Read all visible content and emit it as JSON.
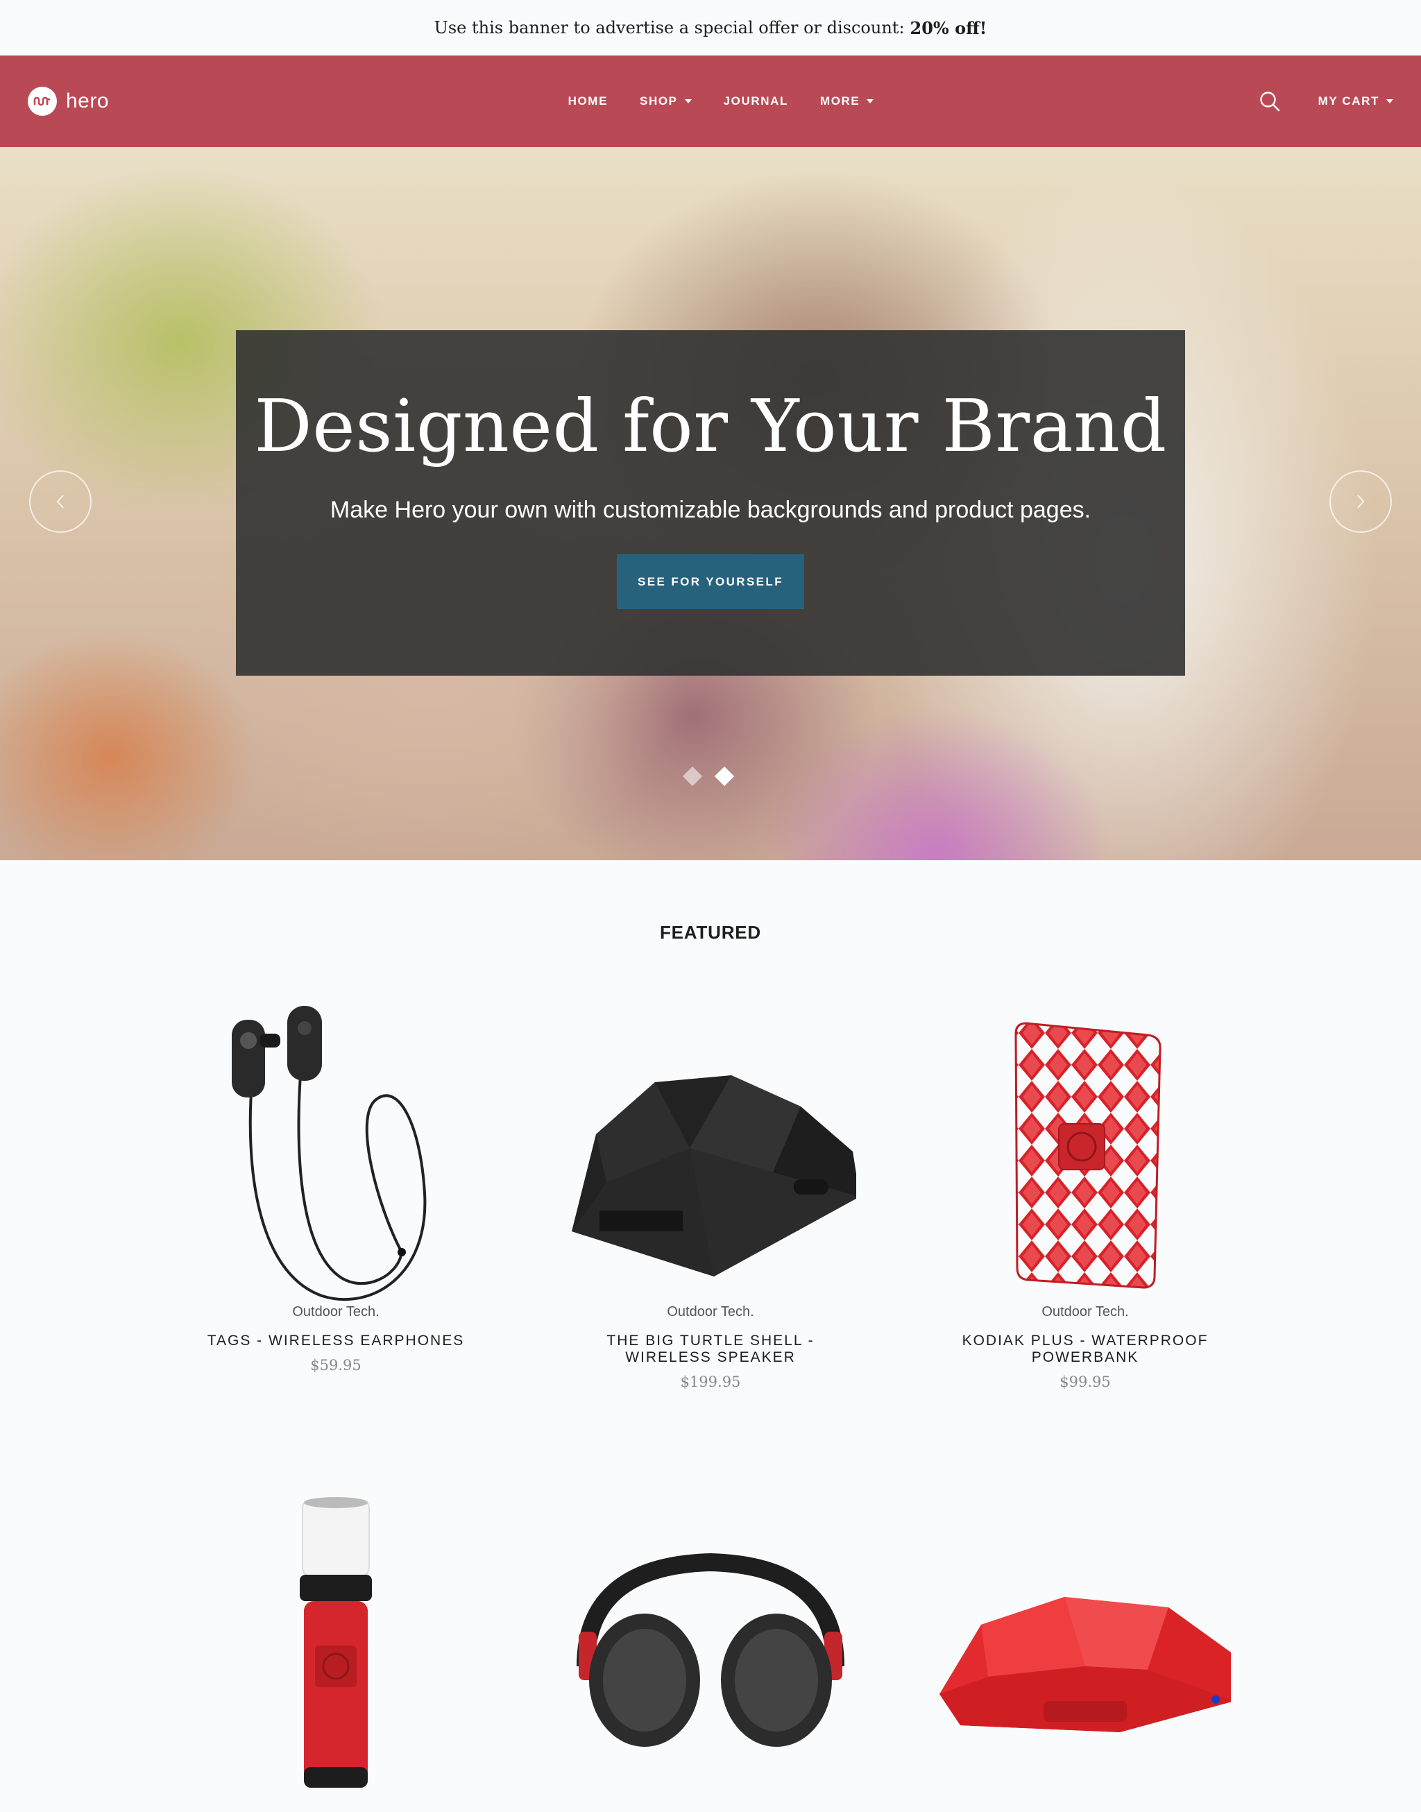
{
  "announcement": {
    "text": "Use this banner to advertise a special offer or discount:",
    "highlight": "20% off!"
  },
  "header": {
    "logo_text": "hero",
    "nav": [
      {
        "label": "HOME",
        "dropdown": false
      },
      {
        "label": "SHOP",
        "dropdown": true
      },
      {
        "label": "JOURNAL",
        "dropdown": false
      },
      {
        "label": "MORE",
        "dropdown": true
      }
    ],
    "cart_label": "MY CART",
    "search_icon": "search-icon"
  },
  "hero": {
    "title": "Designed for Your Brand",
    "subtitle": "Make Hero your own with customizable backgrounds and product pages.",
    "button_label": "SEE FOR YOURSELF",
    "slide_count": 2,
    "active_slide": 2
  },
  "featured": {
    "title": "FEATURED",
    "products": [
      {
        "vendor": "Outdoor Tech.",
        "name": "TAGS - WIRELESS EARPHONES",
        "price": "$59.95",
        "image": "earphones"
      },
      {
        "vendor": "Outdoor Tech.",
        "name": "THE BIG TURTLE SHELL - WIRELESS SPEAKER",
        "price": "$199.95",
        "image": "black-speaker"
      },
      {
        "vendor": "Outdoor Tech.",
        "name": "KODIAK PLUS - WATERPROOF POWERBANK",
        "price": "$99.95",
        "image": "red-powerbank"
      },
      {
        "vendor": "",
        "name": "",
        "price": "",
        "image": "red-lantern"
      },
      {
        "vendor": "",
        "name": "",
        "price": "",
        "image": "headphones"
      },
      {
        "vendor": "",
        "name": "",
        "price": "",
        "image": "red-speaker"
      }
    ]
  },
  "colors": {
    "header_bg": "#b94a55",
    "button_bg": "#27627d",
    "page_bg": "#f9fbfc"
  }
}
